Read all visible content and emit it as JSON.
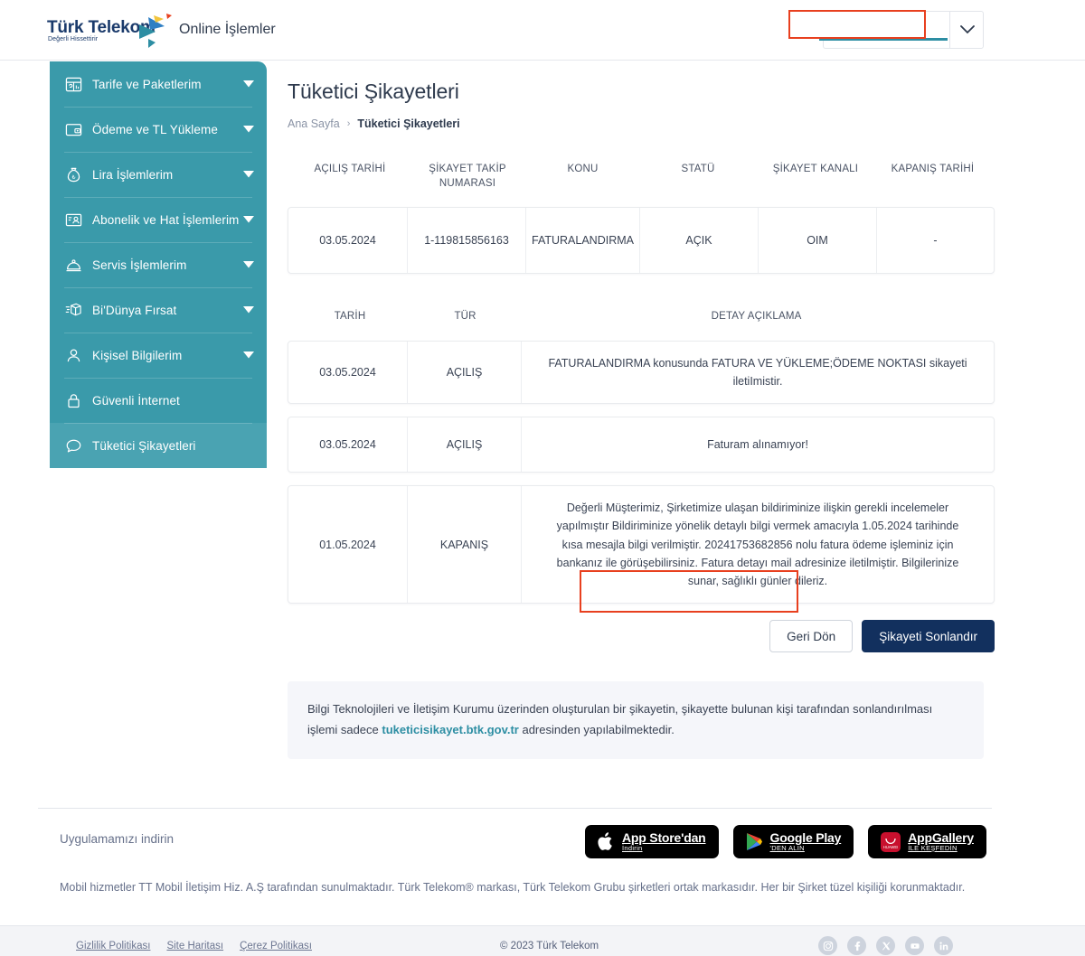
{
  "header": {
    "logo_text": "Türk Telekom",
    "logo_tagline": "Değerli Hissettirir",
    "brand_label": "Online İşlemler",
    "account_value": "",
    "account_placeholder": ""
  },
  "sidebar": {
    "items": [
      {
        "label": "Tarife ve Paketlerim",
        "icon": "calendar-icon",
        "caret": true,
        "selected": false
      },
      {
        "label": "Ödeme ve TL Yükleme",
        "icon": "wallet-icon",
        "caret": true,
        "selected": false
      },
      {
        "label": "Lira İşlemlerim",
        "icon": "money-bag-icon",
        "caret": true,
        "selected": false
      },
      {
        "label": "Abonelik ve Hat İşlemlerim",
        "icon": "id-card-icon",
        "caret": true,
        "selected": false
      },
      {
        "label": "Servis İşlemlerim",
        "icon": "bell-icon",
        "caret": true,
        "selected": false
      },
      {
        "label": "Bi'Dünya Fırsat",
        "icon": "gift-box-icon",
        "caret": true,
        "selected": false
      },
      {
        "label": "Kişisel Bilgilerim",
        "icon": "user-icon",
        "caret": true,
        "selected": false
      },
      {
        "label": "Güvenli İnternet",
        "icon": "lock-icon",
        "caret": false,
        "selected": false
      },
      {
        "label": "Tüketici Şikayetleri",
        "icon": "chat-bubble-icon",
        "caret": false,
        "selected": true
      }
    ]
  },
  "main": {
    "page_title": "Tüketici Şikayetleri",
    "breadcrumb": {
      "home": "Ana Sayfa",
      "separator": "›",
      "current": "Tüketici Şikayetleri"
    },
    "summary_table": {
      "headers": [
        "AÇILIŞ TARİHİ",
        "ŞİKAYET TAKİP NUMARASI",
        "KONU",
        "STATÜ",
        "ŞİKAYET KANALI",
        "KAPANIŞ TARİHİ"
      ],
      "rows": [
        {
          "acilis_tarihi": "03.05.2024",
          "takip_numarasi": "1-119815856163",
          "konu": "FATURALANDIRMA",
          "statu": "AÇIK",
          "kanal": "OIM",
          "kapanis_tarihi": "-"
        }
      ]
    },
    "detail_table": {
      "headers": [
        "TARİH",
        "TÜR",
        "DETAY AÇIKLAMA"
      ],
      "rows": [
        {
          "tarih": "03.05.2024",
          "tur": "AÇILIŞ",
          "detay": "FATURALANDIRMA konusunda FATURA VE YÜKLEME;ÖDEME NOKTASI sikayeti iletiImistir."
        },
        {
          "tarih": "03.05.2024",
          "tur": "AÇILIŞ",
          "detay": "Faturam alınamıyor!"
        },
        {
          "tarih": "01.05.2024",
          "tur": "KAPANIŞ",
          "detay": "Değerli Müşterimiz, Şirketimize ulaşan bildiriminize ilişkin gerekli incelemeler yapılmıştır Bildiriminize yönelik detaylı bilgi vermek amacıyla 1.05.2024 tarihinde kısa mesajla bilgi verilmiştir. 20241753682856 nolu fatura ödeme işleminiz için bankanız ile görüşebilirsiniz. Fatura detayı mail adresinize iletilmiştir. Bilgilerinize sunar, sağlıklı günler dileriz."
        }
      ]
    },
    "buttons": {
      "back": "Geri Dön",
      "finalize": "Şikayeti Sonlandır"
    },
    "info_panel": {
      "text_before": "Bilgi Teknolojileri ve İletişim Kurumu üzerinden oluşturulan bir şikayetin, şikayette bulunan kişi tarafından sonlandırılması işlemi sadece ",
      "link": "tuketicisikayet.btk.gov.tr",
      "text_after": " adresinden yapılabilmektedir."
    }
  },
  "footer": {
    "download_label": "Uygulamamızı indirin",
    "badges": [
      {
        "icon": "apple-icon",
        "line1": "App Store'dan",
        "line2": "İndirin"
      },
      {
        "icon": "google-play-icon",
        "line1": "Google Play",
        "line2": "'DEN ALIN"
      },
      {
        "icon": "appgallery-icon",
        "line1": "AppGallery",
        "line2": "İLE KEŞFEDİN"
      }
    ],
    "legal_text": "Mobil hizmetler TT Mobil İletişim Hiz. A.Ş tarafından sunulmaktadır. Türk Telekom® markası, Türk Telekom Grubu şirketleri ortak markasıdır. Her bir Şirket tüzel kişiliği korunmaktadır.",
    "links": [
      "Gizlilik Politikası",
      "Site Haritası",
      "Çerez Politikası"
    ],
    "copyright": "© 2023 Türk Telekom",
    "socials": [
      "instagram-icon",
      "facebook-icon",
      "x-icon",
      "youtube-icon",
      "linkedin-icon"
    ]
  },
  "annotations": {
    "redaction_color": "#e8401f",
    "count": 2
  },
  "colors": {
    "sidebar_teal": "#3a9aaa",
    "sidebar_selected": "#4aa3b2",
    "primary_navy": "#12305e",
    "link_teal": "#2d8ea3",
    "text_dark": "#2e3a4d"
  }
}
